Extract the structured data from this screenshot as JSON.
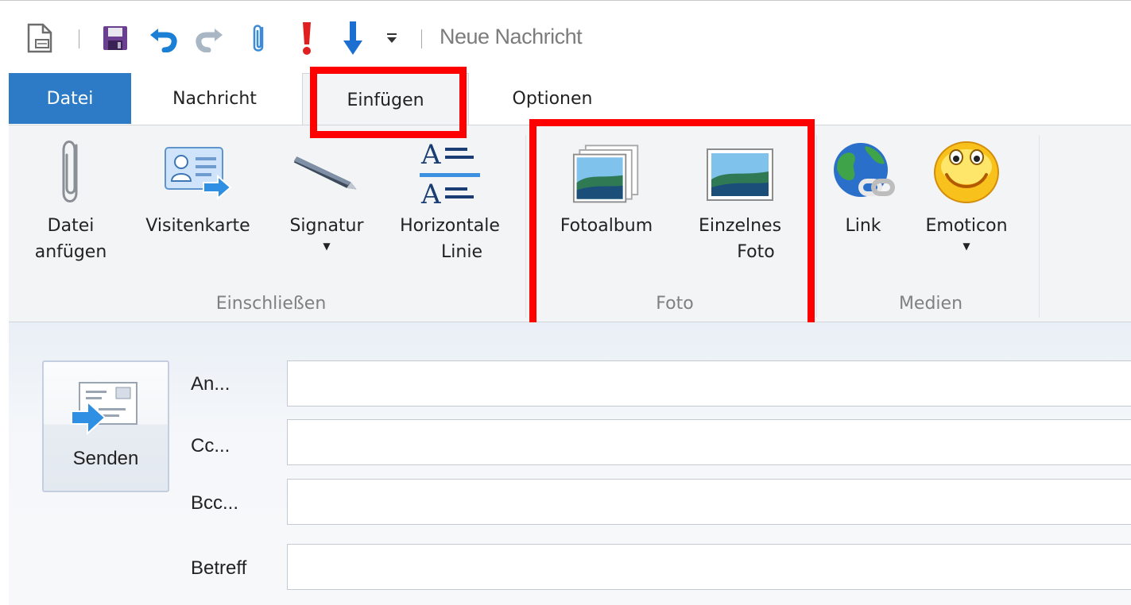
{
  "window": {
    "title": "Neue Nachricht"
  },
  "quick_access": {
    "items": [
      {
        "icon": "new-document-icon"
      },
      {
        "icon": "save-icon"
      },
      {
        "icon": "undo-icon"
      },
      {
        "icon": "redo-icon"
      },
      {
        "icon": "paperclip-icon"
      },
      {
        "icon": "high-priority-icon"
      },
      {
        "icon": "low-priority-icon"
      },
      {
        "icon": "customize-dropdown-icon"
      }
    ]
  },
  "tabs": [
    {
      "label": "Datei"
    },
    {
      "label": "Nachricht"
    },
    {
      "label": "Einfügen",
      "active": true
    },
    {
      "label": "Optionen"
    }
  ],
  "ribbon": {
    "groups": [
      {
        "label": "Einschließen",
        "buttons": [
          {
            "line1": "Datei",
            "line2": "anfügen",
            "icon": "paperclip-icon"
          },
          {
            "line1": "Visitenkarte",
            "line2": "",
            "icon": "business-card-icon"
          },
          {
            "line1": "Signatur",
            "line2": "",
            "icon": "pen-icon",
            "dropdown": true
          },
          {
            "line1": "Horizontale",
            "line2": "Linie",
            "icon": "horizontal-line-icon"
          }
        ]
      },
      {
        "label": "Foto",
        "buttons": [
          {
            "line1": "Fotoalbum",
            "line2": "",
            "icon": "photo-album-icon"
          },
          {
            "line1": "Einzelnes",
            "line2": "Foto",
            "icon": "single-photo-icon"
          }
        ]
      },
      {
        "label": "Medien",
        "buttons": [
          {
            "line1": "Link",
            "line2": "",
            "icon": "globe-link-icon"
          },
          {
            "line1": "Emoticon",
            "line2": "",
            "icon": "smiley-icon",
            "dropdown": true
          }
        ]
      }
    ]
  },
  "compose": {
    "send_label": "Senden",
    "fields": [
      {
        "label": "An...",
        "value": ""
      },
      {
        "label": "Cc...",
        "value": ""
      },
      {
        "label": "Bcc...",
        "value": ""
      },
      {
        "label": "Betreff",
        "value": ""
      }
    ]
  },
  "colors": {
    "file_tab": "#2d7bc6",
    "highlight": "#ff0000",
    "ribbon_bg": "#f3f4f6"
  }
}
